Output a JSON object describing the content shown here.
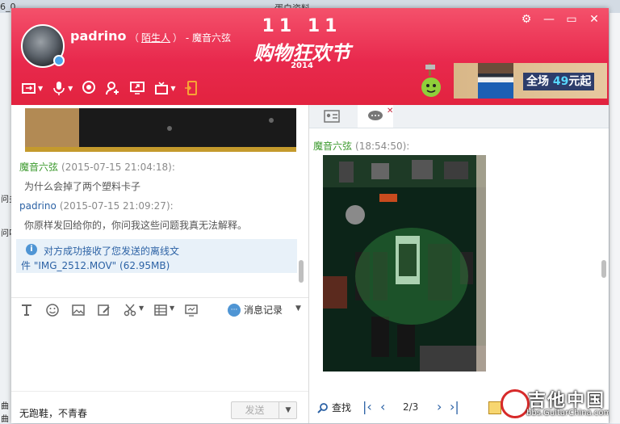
{
  "desktop": {
    "tabs": [
      "6_0",
      "蛋白资料"
    ],
    "left_texts": [
      "问多",
      "问叫",
      "曲",
      "曲 (D:)"
    ]
  },
  "header": {
    "contact_name": "padrino",
    "relation_open": "（",
    "relation": "陌生人",
    "relation_close": "）",
    "group_name": "- 魔音六弦",
    "banner_top": "11 11",
    "banner_text": "购物狂欢节",
    "banner_year": "2014",
    "ad_text_prefix": "全场",
    "ad_number": "49",
    "ad_text_suffix": "元起"
  },
  "window_buttons": {
    "settings": "⚙",
    "minimize": "—",
    "maximize": "▭",
    "close": "✕"
  },
  "messages": [
    {
      "sender": "魔音六弦",
      "time": "(2015-07-15 21:04:18):",
      "text": "为什么会掉了两个塑料卡子"
    },
    {
      "sender": "padrino",
      "time": "(2015-07-15 21:09:27):",
      "text": "你原样发回给你的，你问我这些问题我真无法解释。"
    }
  ],
  "notice": {
    "line1": "对方成功接收了您发送的离线文",
    "line2": "件 \"IMG_2512.MOV\" (62.95MB)"
  },
  "left_toolbar": {
    "history_label": "消息记录"
  },
  "input": {
    "slogan": "无跑鞋，不青春",
    "send_label": "发送"
  },
  "viewer": {
    "sender": "魔音六弦",
    "time": "(18:54:50):",
    "find_label": "查找",
    "pager": "2/3"
  },
  "watermark": {
    "brand": "吉他中国",
    "url": "bbs.GuitarChina.com"
  },
  "colors": {
    "header_red": "#e8294d",
    "accent_blue": "#2c62a5",
    "sender_green": "#3c9a2e"
  }
}
